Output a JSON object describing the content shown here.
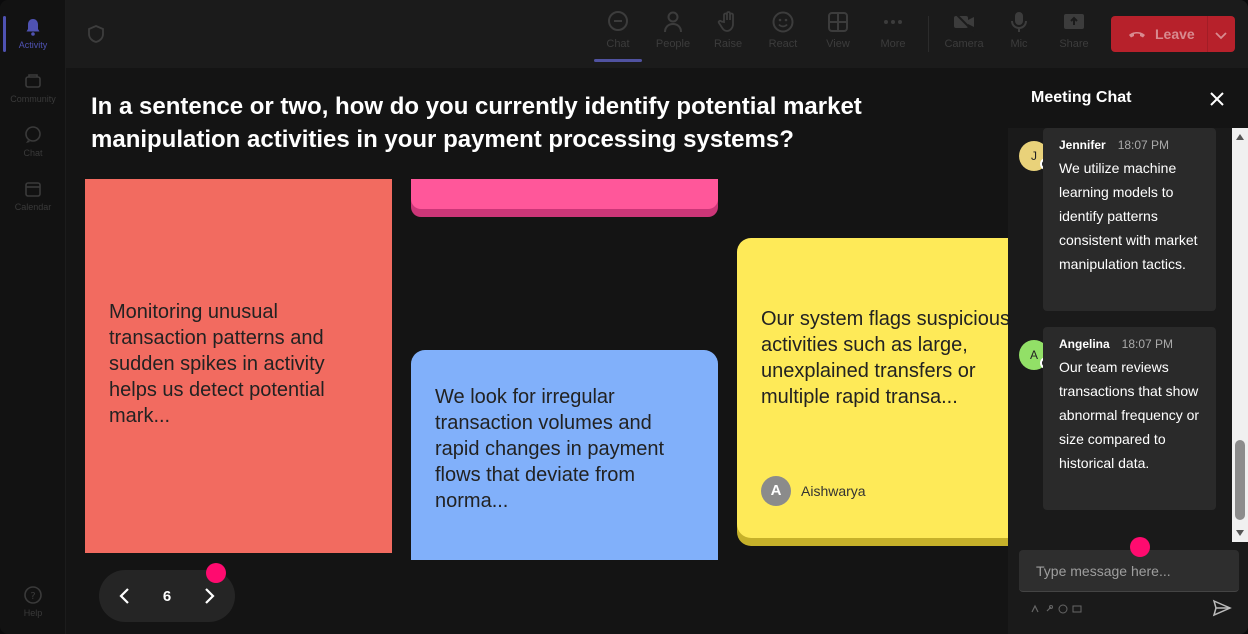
{
  "rail": [
    {
      "label": "Activity",
      "icon": "bell-icon",
      "active": true
    },
    {
      "label": "Community",
      "icon": "community-icon"
    },
    {
      "label": "Chat",
      "icon": "chat-icon"
    },
    {
      "label": "Calendar",
      "icon": "calendar-icon"
    },
    {
      "label": "Help",
      "icon": "help-icon"
    }
  ],
  "toolbar": {
    "chat": "Chat",
    "people": "People",
    "raise": "Raise",
    "react": "React",
    "view": "View",
    "more": "More",
    "camera": "Camera",
    "mic": "Mic",
    "share": "Share",
    "leave": "Leave"
  },
  "question": "In a sentence or two, how do you currently identify potential market manipulation activities in your payment processing systems?",
  "notes": {
    "red": "Monitoring unusual transaction patterns and sudden spikes in activity helps us detect potential mark...",
    "blue": "We look for irregular transaction volumes and rapid changes in payment flows that deviate from norma...",
    "yellow": "Our system flags suspicious activities such as large, unexplained transfers or multiple rapid transa...",
    "yellow_author_initial": "A",
    "yellow_author": "Aishwarya"
  },
  "pager": {
    "page": "6"
  },
  "chat": {
    "title": "Meeting Chat",
    "messages": [
      {
        "initial": "J",
        "name": "Jennifer",
        "time": "18:07 PM",
        "text": "We utilize machine learning models to identify patterns consistent with market manipulation tactics.",
        "color": "#e9d27a"
      },
      {
        "initial": "A",
        "name": "Angelina",
        "time": "18:07 PM",
        "text": "Our team reviews transactions that show abnormal frequency or size compared to historical data.",
        "color": "#92e067"
      }
    ],
    "placeholder": "Type message here..."
  },
  "colors": {
    "accent": "#4f52b2",
    "leave": "#b7212b",
    "pointer_dot": "#ff0b6f"
  }
}
